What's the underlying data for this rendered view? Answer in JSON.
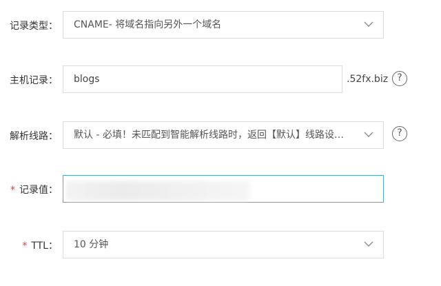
{
  "record_type": {
    "label": "记录类型：",
    "value": "CNAME- 将域名指向另外一个域名"
  },
  "host_record": {
    "label": "主机记录：",
    "value": "blogs",
    "suffix": ".52fx.biz"
  },
  "line": {
    "label": "解析线路：",
    "value": "默认 - 必填！未匹配到智能解析线路时，返回【默认】线路设…"
  },
  "record_value": {
    "required_mark": "*",
    "label": "记录值：",
    "value": ""
  },
  "ttl": {
    "required_mark": "*",
    "label": "TTL：",
    "value": "10 分钟"
  },
  "help_glyph": "?",
  "icons": {
    "dropdown": "chevron-down-icon",
    "help": "question-circle-icon"
  },
  "colors": {
    "required": "#e4393c",
    "focus_border": "#4ea8c6",
    "border": "#dcdcdc"
  }
}
